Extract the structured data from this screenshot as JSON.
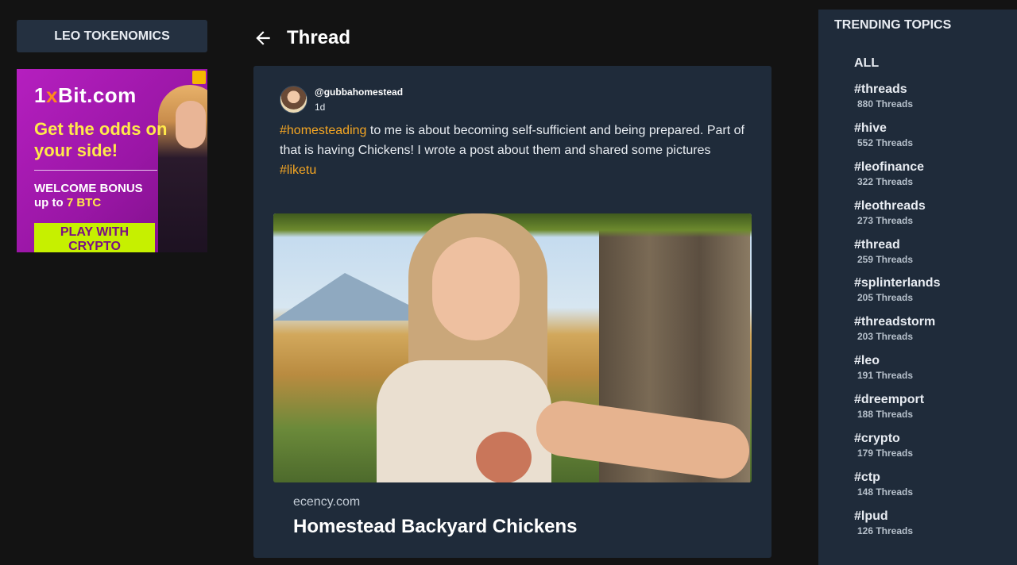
{
  "left": {
    "tokenomics_label": "LEO TOKENOMICS",
    "ad": {
      "brand_pre": "1",
      "brand_x": "x",
      "brand_post": "Bit.com",
      "headline": "Get the odds on your side!",
      "bonus_line1": "WELCOME BONUS",
      "bonus_line2_pre": "up to ",
      "bonus_amount": "7 BTC",
      "cta": "PLAY WITH CRYPTO"
    }
  },
  "thread": {
    "back_icon": "arrow-left-icon",
    "title": "Thread",
    "post": {
      "username": "@gubbahomestead",
      "time": "1d",
      "hashtag1": "#homesteading",
      "text": " to me is about becoming self-sufficient and being prepared. Part of that is having Chickens! I wrote a post about them and shared some pictures",
      "hashtag2": "#liketu",
      "link_domain": "ecency.com",
      "link_title": "Homestead Backyard Chickens"
    }
  },
  "trending": {
    "title": "TRENDING TOPICS",
    "all_label": "ALL",
    "topics": [
      {
        "name": "#threads",
        "count": "880 Threads"
      },
      {
        "name": "#hive",
        "count": "552 Threads"
      },
      {
        "name": "#leofinance",
        "count": "322 Threads"
      },
      {
        "name": "#leothreads",
        "count": "273 Threads"
      },
      {
        "name": "#thread",
        "count": "259 Threads"
      },
      {
        "name": "#splinterlands",
        "count": "205 Threads"
      },
      {
        "name": "#threadstorm",
        "count": "203 Threads"
      },
      {
        "name": "#leo",
        "count": "191 Threads"
      },
      {
        "name": "#dreemport",
        "count": "188 Threads"
      },
      {
        "name": "#crypto",
        "count": "179 Threads"
      },
      {
        "name": "#ctp",
        "count": "148 Threads"
      },
      {
        "name": "#lpud",
        "count": "126 Threads"
      }
    ]
  },
  "colors": {
    "background": "#131313",
    "panel": "#1f2b3a",
    "hashtag": "#f5a623"
  }
}
